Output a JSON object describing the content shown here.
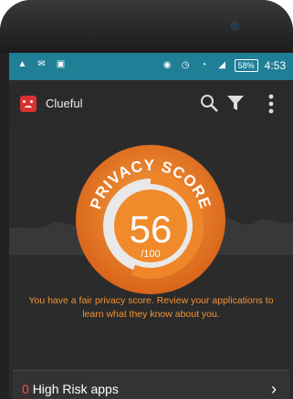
{
  "statusbar": {
    "left_icons": [
      "warning-icon",
      "mail-icon",
      "image-icon"
    ],
    "battery": "58%",
    "time": "4:53"
  },
  "appbar": {
    "title": "Clueful"
  },
  "score": {
    "label": "PRIVACY SCORE",
    "value": "56",
    "max": "/100",
    "fraction": 0.56
  },
  "caption": "You have a fair privacy score. Review your applications to learn what they know about you.",
  "risk_row": {
    "count": "0",
    "label": "High Risk apps",
    "chevron": "›"
  },
  "colors": {
    "statusbar": "#1f7f96",
    "accent": "#f39237",
    "risk": "#ff4b4b"
  }
}
